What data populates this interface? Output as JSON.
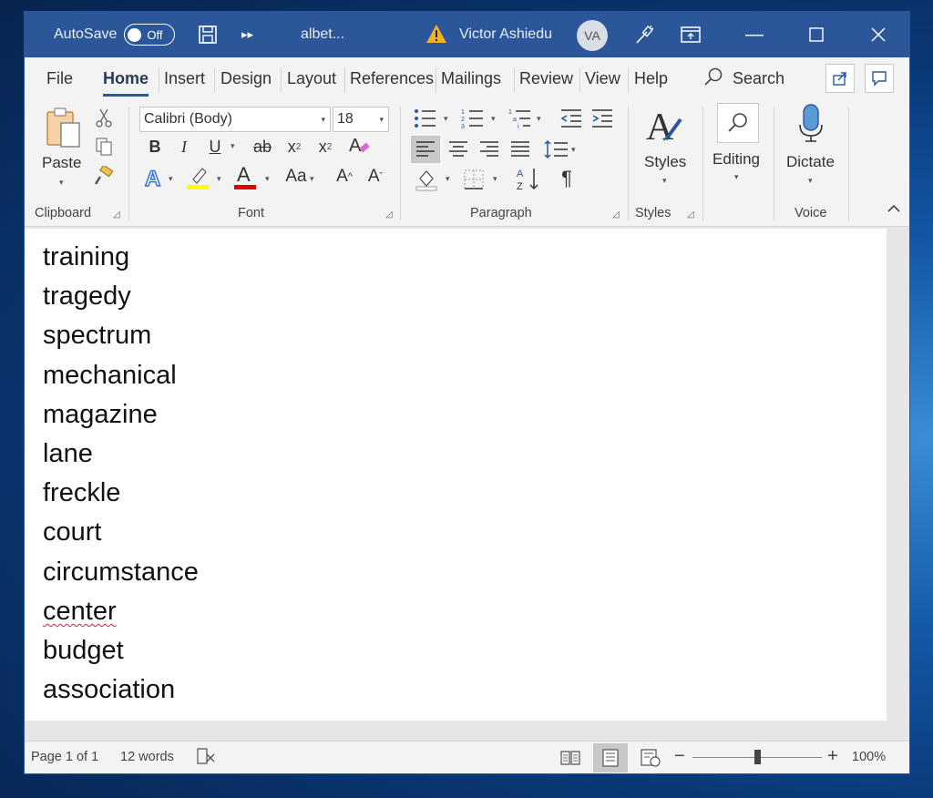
{
  "titlebar": {
    "autosave_label": "AutoSave",
    "autosave_state": "Off",
    "file_name": "albet...",
    "user_name": "Victor Ashiedu",
    "user_initials": "VA"
  },
  "tabs": [
    "File",
    "Home",
    "Insert",
    "Design",
    "Layout",
    "References",
    "Mailings",
    "Review",
    "View",
    "Help"
  ],
  "active_tab": "Home",
  "search_label": "Search",
  "ribbon": {
    "clipboard": {
      "label": "Clipboard",
      "paste_label": "Paste"
    },
    "font": {
      "label": "Font",
      "font_name": "Calibri (Body)",
      "font_size": "18",
      "change_case": "Aa"
    },
    "paragraph": {
      "label": "Paragraph"
    },
    "styles": {
      "label": "Styles",
      "button_label": "Styles"
    },
    "editing": {
      "button_label": "Editing"
    },
    "voice": {
      "label": "Voice",
      "button_label": "Dictate"
    }
  },
  "document": {
    "lines": [
      "training",
      "tragedy",
      "spectrum",
      "mechanical",
      "magazine",
      "lane",
      "freckle",
      "court",
      "circumstance",
      "center",
      "budget",
      "association"
    ],
    "misspelled_index": 9
  },
  "status": {
    "page": "Page 1 of 1",
    "words": "12 words",
    "zoom": "100%",
    "zoom_level": 1.0
  },
  "colors": {
    "accent": "#2b579a",
    "highlight": "#ffff00",
    "font_color": "#e00000"
  }
}
